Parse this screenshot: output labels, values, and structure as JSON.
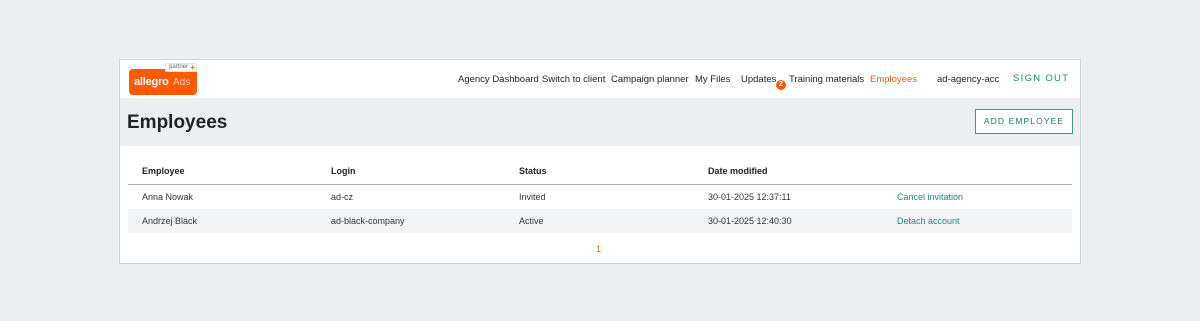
{
  "logo": {
    "brand": "allegro",
    "suffix": "Ads",
    "partner": "partner",
    "plus": "+"
  },
  "nav": {
    "items": [
      "Agency Dashboard",
      "Switch to client",
      "Campaign planner",
      "My Files",
      "Updates",
      "Training materials",
      "Employees"
    ],
    "updates_badge": "2",
    "account": "ad-agency-acc",
    "sign_out": "SIGN OUT"
  },
  "page": {
    "title": "Employees",
    "add_button": "ADD EMPLOYEE"
  },
  "table": {
    "headers": [
      "Employee",
      "Login",
      "Status",
      "Date modified"
    ],
    "rows": [
      {
        "employee": "Anna Nowak",
        "login": "ad-cz",
        "status": "Invited",
        "date": "30-01-2025 12:37:11",
        "action": "Cancel invitation"
      },
      {
        "employee": "Andrzej Black",
        "login": "ad-black-company",
        "status": "Active",
        "date": "30-01-2025 12:40:30",
        "action": "Detach account"
      }
    ]
  },
  "pagination": {
    "current": "1"
  },
  "colors": {
    "accent": "#ff5a00",
    "link": "#1a8a78",
    "band": "#eceff1"
  }
}
